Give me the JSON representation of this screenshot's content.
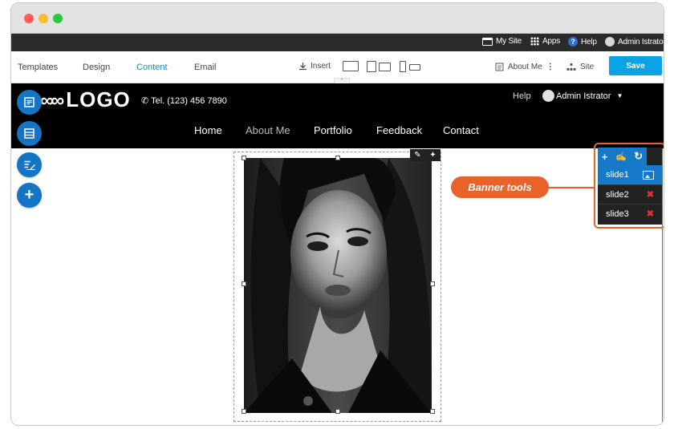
{
  "adminbar": {
    "my_site": "My Site",
    "apps": "Apps",
    "help": "Help",
    "user": "Admin Istrator"
  },
  "toolbar": {
    "tabs": [
      "Templates",
      "Design",
      "Content",
      "Email"
    ],
    "active_tab": "Content",
    "insert": "Insert",
    "page": "About Me",
    "site": "Site",
    "save": "Save"
  },
  "site": {
    "logo": "LOGO",
    "tel": "Tel. (123) 456 7890",
    "help": "Help",
    "user": "Admin Istrator",
    "nav": [
      "Home",
      "About Me",
      "Portfolio",
      "Feedback",
      "Contact"
    ]
  },
  "callout": "Banner tools",
  "banner_tools": {
    "slides": [
      {
        "label": "slide1",
        "icon": "image-icon"
      },
      {
        "label": "slide2",
        "icon": "delete-icon"
      },
      {
        "label": "slide3",
        "icon": "delete-icon"
      }
    ]
  },
  "colors": {
    "accent": "#1679c9",
    "save": "#0aa3e6",
    "callout": "#e8622a",
    "adminbar": "#2b2b2b",
    "header": "#000000"
  }
}
